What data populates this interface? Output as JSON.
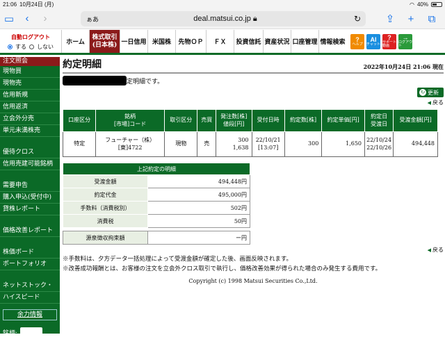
{
  "status_bar": {
    "time": "21:06",
    "date": "10月24日 (月)",
    "battery": "40%"
  },
  "browser": {
    "reader_label": "ぁあ",
    "url": "deal.matsui.co.jp"
  },
  "topnav": {
    "autologout_title": "自動ログアウト",
    "autologout_on": "する",
    "autologout_off": "しない",
    "items": [
      "ホーム",
      "一日信用",
      "米国株",
      "先物ＯＰ",
      "ＦＸ",
      "投資信託",
      "資産状況",
      "口座管理",
      "情報検索"
    ],
    "active_line1": "株式取引",
    "active_line2": "(日本株)",
    "help_buttons": [
      {
        "mark": "?",
        "label": "ヘルプ",
        "color": "#f08a00"
      },
      {
        "mark": "AI",
        "label": "チャット",
        "color": "#1a8fe0"
      },
      {
        "mark": "?",
        "label": "サポート動画",
        "color": "#d22"
      },
      {
        "mark": "→",
        "label": "ログアウト",
        "color": "#2a9a3a"
      }
    ]
  },
  "sidebar": {
    "header": "注文照会",
    "group1": [
      "現物買",
      "現物売",
      "信用新規",
      "信用返済",
      "立会外分売",
      "単元未満株売"
    ],
    "group2": [
      "優待クロス",
      "信用売建可能銘柄"
    ],
    "group3": [
      "需要申告",
      "購入申込(受付中)",
      "貸株レポート"
    ],
    "group4": [
      "価格改善レポート"
    ],
    "group5": [
      "株価ボード",
      "ポートフォリオ"
    ],
    "group6": [
      "ネットストック・",
      "ハイスピード"
    ],
    "yoryoku": "余力情報",
    "meigara_label": "銘柄:"
  },
  "page": {
    "title": "約定明細",
    "datetime": "2022年10月24日 21:06 現在",
    "message": "定明細です。",
    "refresh_label": "更新",
    "back_label": "戻る"
  },
  "order_table": {
    "headers": [
      "口座区分",
      "銘柄\n[市場]コード",
      "取引区分",
      "売買",
      "発注数[株]\n値段[円]",
      "受付日時",
      "約定数[株]",
      "約定単価[円]",
      "約定日\n受渡日",
      "受渡金額[円]"
    ],
    "row": {
      "account": "特定",
      "name": "フューチャー（株）",
      "code": "[東]4722",
      "trade_type": "現物",
      "side": "売",
      "order_qty": "300",
      "order_price": "1,638",
      "recv_date": "22/10/21",
      "recv_time": "[13:07]",
      "exec_qty": "300",
      "exec_price": "1,650",
      "exec_date": "22/10/24",
      "settle_date": "22/10/26",
      "amount": "494,448"
    }
  },
  "detail_table": {
    "header": "上記約定の明細",
    "rows": [
      {
        "label": "受渡金額",
        "value": "494,448円"
      },
      {
        "label": "約定代金",
        "value": "495,000円"
      },
      {
        "label": "手数料（消費税別）",
        "value": "502円"
      },
      {
        "label": "消費税",
        "value": "50円"
      }
    ]
  },
  "gensen": {
    "label": "源泉徴収拘束額",
    "value": "ー円"
  },
  "notes": [
    "※手数料は、夕方データ一括処理によって受渡金額が確定した後、画面反映されます。",
    "※改善成功報酬とは、お客様の注文を立会外クロス取引で執行し、価格改善効果が得られた場合のみ発生する費用です。"
  ],
  "copyright": "Copyright (c) 1998 Matsui Securities Co.,Ltd."
}
